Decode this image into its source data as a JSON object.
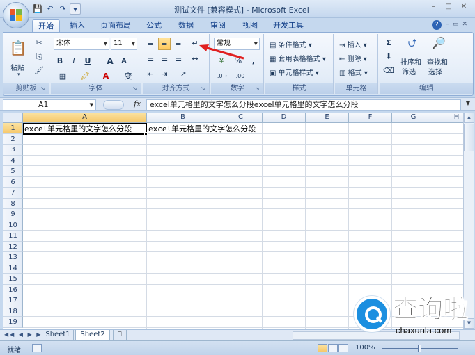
{
  "window": {
    "title": "测试文件",
    "mode": "[兼容模式]",
    "app": "Microsoft Excel"
  },
  "tabs": [
    {
      "label": "开始",
      "active": true
    },
    {
      "label": "插入"
    },
    {
      "label": "页面布局"
    },
    {
      "label": "公式"
    },
    {
      "label": "数据"
    },
    {
      "label": "审阅"
    },
    {
      "label": "视图"
    },
    {
      "label": "开发工具"
    }
  ],
  "ribbon": {
    "clipboard": {
      "label": "剪贴板",
      "paste": "粘贴"
    },
    "font": {
      "label": "字体",
      "name": "宋体",
      "size": "11",
      "bold": "B",
      "italic": "I",
      "underline": "U",
      "grow": "A",
      "shrink": "A",
      "wen": "变"
    },
    "align": {
      "label": "对齐方式"
    },
    "number": {
      "label": "数字",
      "format": "常规",
      "percent": "%",
      "comma": ","
    },
    "styles": {
      "label": "样式",
      "cond": "条件格式",
      "table": "套用表格格式",
      "cell": "单元格样式"
    },
    "cells": {
      "label": "单元格",
      "insert": "插入",
      "delete": "删除",
      "format": "格式"
    },
    "edit": {
      "label": "编辑",
      "sigma": "Σ",
      "sort": "排序和",
      "sort2": "筛选",
      "find": "查找和",
      "find2": "选择"
    }
  },
  "formula_bar": {
    "name_box": "A1",
    "fx": "fx",
    "content": "excel单元格里的文字怎么分段excel单元格里的文字怎么分段"
  },
  "grid": {
    "columns": [
      "A",
      "B",
      "C",
      "D",
      "E",
      "F",
      "G",
      "H"
    ],
    "rows": [
      "1",
      "2",
      "3",
      "4",
      "5",
      "6",
      "7",
      "8",
      "9",
      "10",
      "11",
      "12",
      "13",
      "14",
      "15",
      "16",
      "17",
      "18",
      "19"
    ],
    "cells": {
      "A1": "excel单元格里的文字怎么分段",
      "B1": "excel单元格里的文字怎么分段"
    }
  },
  "sheets": [
    {
      "label": "Sheet1"
    },
    {
      "label": "Sheet2",
      "active": true
    }
  ],
  "status": {
    "ready": "就绪",
    "zoom": "100%"
  },
  "watermark": {
    "title": "查询啦",
    "url": "chaxunla.com"
  }
}
